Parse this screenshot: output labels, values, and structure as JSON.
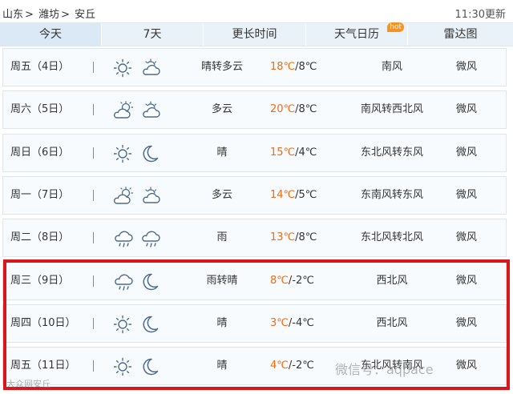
{
  "breadcrumb": {
    "province": "山东",
    "city": "潍坊",
    "county": "安丘",
    "separator": ">"
  },
  "update_time": "11:30更新",
  "tabs": [
    {
      "label": "今天",
      "hot": ""
    },
    {
      "label": "7天",
      "hot": ""
    },
    {
      "label": "更长时间",
      "hot": ""
    },
    {
      "label": "天气日历",
      "hot": "hot"
    },
    {
      "label": "雷达图",
      "hot": ""
    }
  ],
  "rows": [
    {
      "day": "周五（4日）",
      "icon_day": "sun-icon",
      "icon_night": "cloud-icon",
      "condition": "晴转多云",
      "high": "18℃",
      "low": "/8℃",
      "wind": "南风",
      "force": "微风"
    },
    {
      "day": "周六（5日）",
      "icon_day": "partly-cloudy-icon",
      "icon_night": "cloud-icon",
      "condition": "多云",
      "high": "20℃",
      "low": "/8℃",
      "wind": "南风转西北风",
      "force": "微风"
    },
    {
      "day": "周日（6日）",
      "icon_day": "sun-icon",
      "icon_night": "moon-icon",
      "condition": "晴",
      "high": "15℃",
      "low": "/4℃",
      "wind": "东北风转东风",
      "force": "微风"
    },
    {
      "day": "周一（7日）",
      "icon_day": "partly-cloudy-icon",
      "icon_night": "cloud-icon",
      "condition": "多云",
      "high": "14℃",
      "low": "/5℃",
      "wind": "东南风转东风",
      "force": "微风"
    },
    {
      "day": "周二（8日）",
      "icon_day": "rain-icon",
      "icon_night": "rain-icon",
      "condition": "雨",
      "high": "13℃",
      "low": "/8℃",
      "wind": "东北风转北风",
      "force": "微风"
    },
    {
      "day": "周三（9日）",
      "icon_day": "rain-icon",
      "icon_night": "moon-icon",
      "condition": "雨转晴",
      "high": "8℃",
      "low": "/-2℃",
      "wind": "西北风",
      "force": "微风"
    },
    {
      "day": "周四（10日）",
      "icon_day": "sun-icon",
      "icon_night": "moon-icon",
      "condition": "晴",
      "high": "3℃",
      "low": "/-4℃",
      "wind": "西北风",
      "force": "微风"
    },
    {
      "day": "周五（11日）",
      "icon_day": "sun-icon",
      "icon_night": "moon-icon",
      "condition": "晴",
      "high": "4℃",
      "low": "/-2℃",
      "wind": "东北风转南风",
      "force": "微风"
    }
  ],
  "watermark": {
    "right": "微信号：aqpace",
    "left": "大众网安丘"
  },
  "colors": {
    "temp_high": "#f06a0e",
    "highlight_border": "#d9161c",
    "hot_badge": "#f7931e",
    "icon_stroke": "#4a6b8f"
  }
}
